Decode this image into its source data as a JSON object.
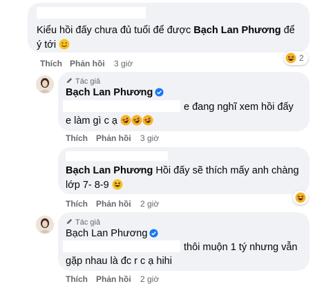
{
  "comments": [
    {
      "text_part1": "Kiểu hồi đấy chưa đủ tuổi để được ",
      "mention": "Bạch Lan Phương",
      "text_part2": " để",
      "text_line2": "ý tới",
      "like": "Thích",
      "reply": "Phản hồi",
      "time": "3 giờ",
      "reaction_count": "2"
    },
    {
      "author_tag": "Tác giả",
      "author": "Bạch Lan Phương",
      "line1": "e đang nghĩ xem hồi đấy",
      "line2": "e làm gì c ạ",
      "like": "Thích",
      "reply": "Phản hồi",
      "time": "3 giờ"
    },
    {
      "author": "Bạch Lan Phương",
      "line1": " Hồi đấy sẽ thích mấy anh chàng",
      "line2": "lớp 7- 8-9",
      "like": "Thích",
      "reply": "Phản hồi",
      "time": "2 giờ"
    },
    {
      "author_tag": "Tác giả",
      "author": "Bạch Lan Phương",
      "line1": "thôi muộn 1 tý nhưng vẫn",
      "line2": "gặp nhau là đc r c ạ hihi",
      "like": "Thích",
      "reply": "Phản hồi",
      "time": "2 giờ"
    }
  ],
  "icons": {
    "smile": "slightly-smiling-face-icon",
    "laugh": "rolling-laughing-icon",
    "grin": "grinning-squinting-face-icon",
    "verified": "verified-badge-icon",
    "author": "pencil-author-icon"
  },
  "colors": {
    "bubble": "#f0f2f5",
    "meta": "#65676b",
    "verified": "#1877f2",
    "emoji": "#f7b125"
  }
}
